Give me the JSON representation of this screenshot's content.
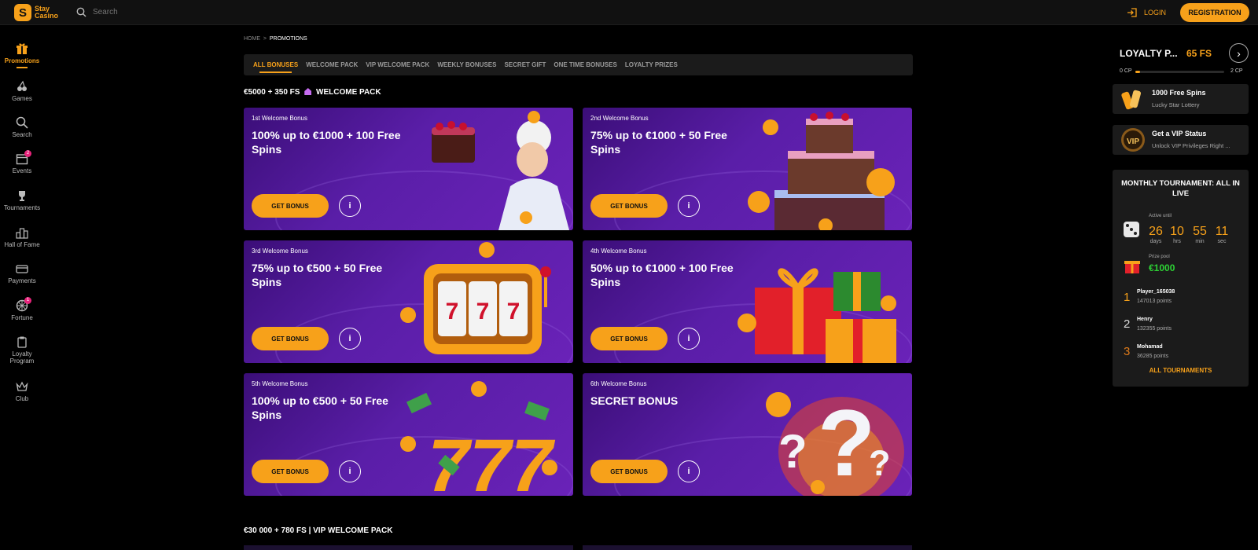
{
  "header": {
    "logo_line1": "Stay",
    "logo_line2": "Casino",
    "search_placeholder": "Search",
    "login": "LOGIN",
    "register": "REGISTRATION"
  },
  "sidebar": [
    {
      "label": "Promotions",
      "icon": "gift-icon"
    },
    {
      "label": "Games",
      "icon": "cherries-icon"
    },
    {
      "label": "Search",
      "icon": "search-icon"
    },
    {
      "label": "Events",
      "icon": "calendar-icon",
      "badge": "2"
    },
    {
      "label": "Tournaments",
      "icon": "trophy-icon"
    },
    {
      "label": "Hall of Fame",
      "icon": "podium-icon"
    },
    {
      "label": "Payments",
      "icon": "card-icon"
    },
    {
      "label": "Fortune",
      "icon": "wheel-icon",
      "badge": "1"
    },
    {
      "label": "Loyalty",
      "label2": "Program",
      "icon": "clipboard-icon"
    },
    {
      "label": "Club",
      "icon": "crown-icon"
    }
  ],
  "breadcrumb": {
    "home": "HOME",
    "sep": ">",
    "current": "PROMOTIONS"
  },
  "tabs": [
    "ALL BONUSES",
    "WELCOME PACK",
    "VIP WELCOME PACK",
    "WEEKLY BONUSES",
    "SECRET GIFT",
    "ONE TIME BONUSES",
    "LOYALTY PRIZES"
  ],
  "section1": {
    "prefix": "€5000 + 350 FS",
    "title": "WELCOME PACK"
  },
  "section2": {
    "title": "€30 000 + 780 FS | VIP WELCOME PACK"
  },
  "cards": [
    {
      "label": "1st Welcome Bonus",
      "headline": "100% up to €1000 + 100 Free Spins",
      "cta": "GET BONUS",
      "info": "i"
    },
    {
      "label": "2nd Welcome Bonus",
      "headline": "75% up to €1000 + 50 Free Spins",
      "cta": "GET BONUS",
      "info": "i"
    },
    {
      "label": "3rd Welcome Bonus",
      "headline": "75% up to €500 + 50 Free Spins",
      "cta": "GET BONUS",
      "info": "i"
    },
    {
      "label": "4th Welcome Bonus",
      "headline": "50% up to €1000 + 100 Free Spins",
      "cta": "GET BONUS",
      "info": "i"
    },
    {
      "label": "5th Welcome Bonus",
      "headline": "100% up to €500 + 50 Free Spins",
      "cta": "GET BONUS",
      "info": "i"
    },
    {
      "label": "6th Welcome Bonus",
      "headline": "SECRET BONUS",
      "cta": "GET BONUS",
      "info": "i"
    }
  ],
  "loyalty": {
    "title": "LOYALTY P...",
    "fs": "65 FS",
    "cp_left": "0 CP",
    "cp_right": "2 CP",
    "progress": 0.05
  },
  "promos": [
    {
      "title": "1000 Free Spins",
      "subtitle": "Lucky Star Lottery"
    },
    {
      "title": "Get a VIP Status",
      "subtitle": "Unlock VIP Privileges Right ..."
    }
  ],
  "tournament": {
    "title": "MONTHLY TOURNAMENT: ALL IN LIVE",
    "active_until": "Active until",
    "countdown": [
      {
        "n": "26",
        "u": "days"
      },
      {
        "n": "10",
        "u": "hrs"
      },
      {
        "n": "55",
        "u": "min"
      },
      {
        "n": "11",
        "u": "sec"
      }
    ],
    "prize_label": "Prize pool",
    "prize": "€1000",
    "leaders": [
      {
        "rank": "1",
        "name": "Player_165038",
        "points": "147013 points"
      },
      {
        "rank": "2",
        "name": "Henry",
        "points": "132355 points"
      },
      {
        "rank": "3",
        "name": "Mohamad",
        "points": "36285 points"
      }
    ],
    "all": "ALL TOURNAMENTS"
  },
  "colors": {
    "accent": "#f7a11a",
    "card_purple": "#5a1ea8",
    "prize_green": "#2dd235"
  }
}
